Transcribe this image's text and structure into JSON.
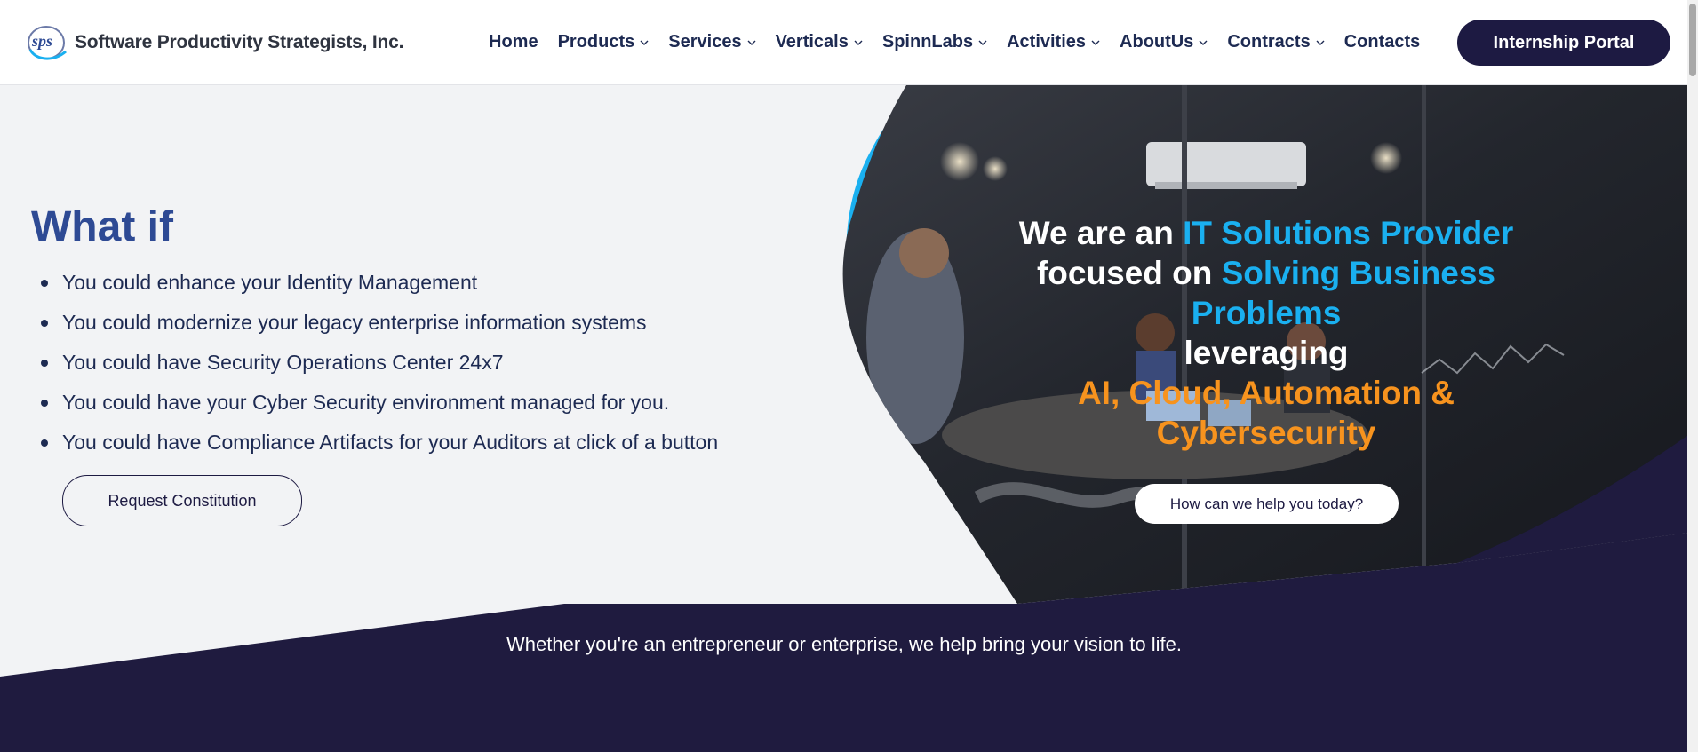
{
  "header": {
    "logo_mark": "sps",
    "company_name": "Software Productivity Strategists, Inc.",
    "nav": [
      {
        "label": "Home",
        "has_dropdown": false
      },
      {
        "label": "Products",
        "has_dropdown": true
      },
      {
        "label": "Services",
        "has_dropdown": true
      },
      {
        "label": "Verticals",
        "has_dropdown": true
      },
      {
        "label": "SpinnLabs",
        "has_dropdown": true
      },
      {
        "label": "Activities",
        "has_dropdown": true
      },
      {
        "label": "AboutUs",
        "has_dropdown": true
      },
      {
        "label": "Contracts",
        "has_dropdown": true
      },
      {
        "label": "Contacts",
        "has_dropdown": false
      }
    ],
    "portal_button": "Internship Portal"
  },
  "whatif": {
    "title": "What if",
    "bullets": [
      "You could enhance your Identity Management",
      "You could modernize your legacy enterprise information systems",
      "You could have Security Operations Center 24x7",
      "You could have your Cyber Security environment managed for you.",
      "You could have Compliance Artifacts for your Auditors at click of a button"
    ],
    "button": "Request Constitution"
  },
  "hero": {
    "line1_a": "We are an ",
    "line1_b": "IT Solutions Provider",
    "line2_a": "focused on ",
    "line2_b": "Solving Business Problems",
    "line3": "leveraging",
    "line4": "AI, Cloud, Automation & Cybersecurity",
    "button": "How can we help you today?"
  },
  "tagline": "Whether you're an entrepreneur or enterprise, we help bring your vision to life.",
  "colors": {
    "navy": "#1d1a42",
    "title_blue": "#2e4a94",
    "accent_blue": "#1ab0f0",
    "accent_orange": "#f7931e",
    "page_bg": "#f2f3f5"
  },
  "icons": {
    "dropdown": "chevron-down-icon",
    "logo": "sps-logo-icon"
  }
}
